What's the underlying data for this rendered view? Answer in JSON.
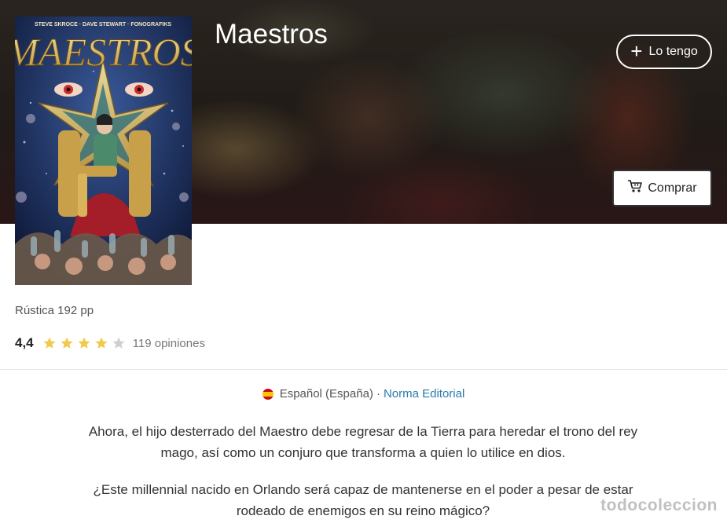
{
  "product": {
    "title": "Maestros",
    "cover": {
      "credits": "STEVE SKROCE · DAVE STEWART · FONOGRAFIKS",
      "logo": "MAESTROS"
    },
    "format": "Rústica 192 pp",
    "rating": {
      "score": "4,4",
      "stars": 4,
      "max_stars": 5,
      "reviews_label": "119 opiniones"
    },
    "language": "Español (España)",
    "separator": "·",
    "publisher": "Norma Editorial",
    "description": [
      "Ahora, el hijo desterrado del Maestro debe regresar de la Tierra para heredar el trono del rey mago, así como un conjuro que transforma a quien lo utilice en dios.",
      "¿Este millennial nacido en Orlando será capaz de mantenerse en el poder a pesar de estar rodeado de enemigos en su reino mágico?"
    ]
  },
  "actions": {
    "own_label": "Lo tengo",
    "own_icon": "plus-icon",
    "buy_label": "Comprar",
    "buy_icon": "cart-icon"
  },
  "watermark": "todocoleccion",
  "colors": {
    "star_filled": "#f2c94c",
    "star_empty": "#cfcfcf",
    "link": "#2a7aa8"
  }
}
